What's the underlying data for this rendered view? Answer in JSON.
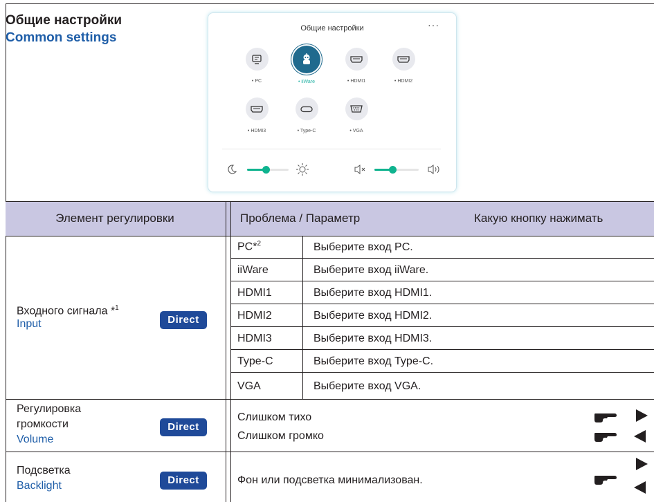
{
  "header": {
    "title_ru": "Общие настройки",
    "title_en": "Common settings"
  },
  "panel": {
    "title": "Общие настройки",
    "more": "···",
    "sources": [
      {
        "label": "PC",
        "icon": "monitor-icon"
      },
      {
        "label": "iiWare",
        "icon": "robot-icon",
        "selected": true
      },
      {
        "label": "HDMI1",
        "icon": "hdmi-icon"
      },
      {
        "label": "HDMI2",
        "icon": "hdmi-icon"
      },
      {
        "label": "HDMI3",
        "icon": "hdmi-icon"
      },
      {
        "label": "Type-C",
        "icon": "usb-c-icon"
      },
      {
        "label": "VGA",
        "icon": "vga-icon"
      }
    ],
    "brightness_level": 0.45,
    "volume_level": 0.4,
    "accent": "#0fb38f"
  },
  "table": {
    "headers": {
      "item": "Элемент регулировки",
      "problem": "Проблема / Параметр",
      "button": "Какую кнопку нажимать"
    },
    "input": {
      "label_ru": "Входного сигнала *",
      "sup": "1",
      "label_en": "Input",
      "direct": "Direct",
      "rows": [
        {
          "src": "PC*",
          "sup": "2",
          "desc": "Выберите вход PC."
        },
        {
          "src": "iiWare",
          "desc": "Выберите вход iiWare."
        },
        {
          "src": "HDMI1",
          "desc": "Выберите вход HDMI1."
        },
        {
          "src": "HDMI2",
          "desc": "Выберите вход HDMI2."
        },
        {
          "src": "HDMI3",
          "desc": "Выберите вход HDMI3."
        },
        {
          "src": "Type-C",
          "desc": "Выберите вход Type-C."
        },
        {
          "src": "VGA",
          "desc": "Выберите вход VGA."
        }
      ]
    },
    "volume": {
      "label_ru_1": "Регулировка",
      "label_ru_2": "громкости",
      "label_en": "Volume",
      "direct": "Direct",
      "line1": "Слишком тихо",
      "line2": "Слишком громко"
    },
    "backlight": {
      "label_ru": "Подсветка",
      "label_en": "Backlight",
      "direct": "Direct",
      "line": "Фон или подсветка минимализован."
    }
  }
}
